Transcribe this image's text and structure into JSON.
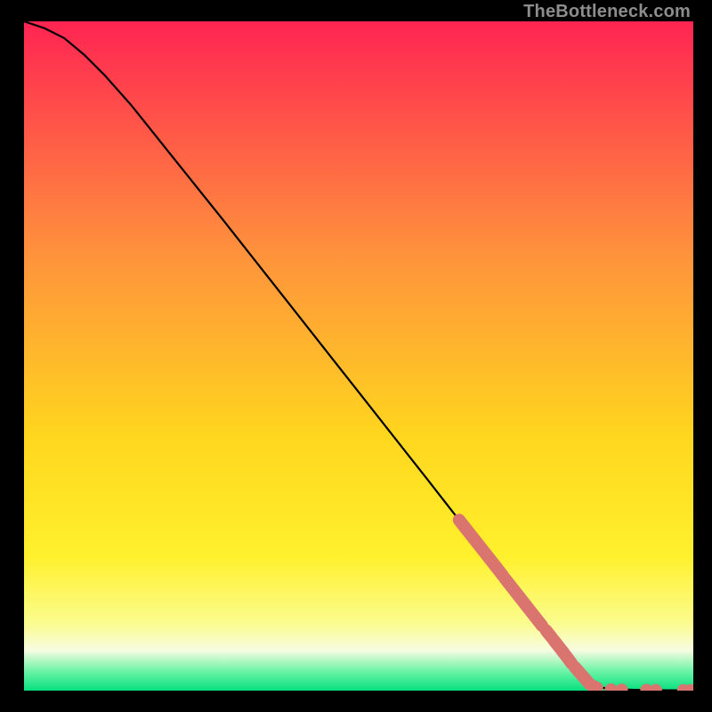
{
  "watermark": "TheBottleneck.com",
  "colors": {
    "page_bg": "#000000",
    "curve": "#000000",
    "marker_fill": "#d9746f",
    "marker_stroke": "#d9746f",
    "grad_top": "#ff2452",
    "grad_upper_mid": "#ff933c",
    "grad_mid": "#ffd61e",
    "grad_yellow2": "#fff12d",
    "grad_pale": "#fbfc8f",
    "grad_cream": "#f7fce1",
    "grad_mint": "#6ff4a8",
    "grad_bottom": "#07e07e"
  },
  "chart_data": {
    "type": "line",
    "title": "",
    "xlabel": "",
    "ylabel": "",
    "xlim": [
      0,
      100
    ],
    "ylim": [
      0,
      100
    ],
    "grid": false,
    "legend": "none",
    "curve": [
      {
        "x": 0.0,
        "y": 100.0
      },
      {
        "x": 3.0,
        "y": 99.0
      },
      {
        "x": 6.0,
        "y": 97.5
      },
      {
        "x": 9.0,
        "y": 95.0
      },
      {
        "x": 12.0,
        "y": 92.0
      },
      {
        "x": 16.0,
        "y": 87.5
      },
      {
        "x": 22.0,
        "y": 80.0
      },
      {
        "x": 30.0,
        "y": 70.0
      },
      {
        "x": 40.0,
        "y": 57.3
      },
      {
        "x": 50.0,
        "y": 44.6
      },
      {
        "x": 60.0,
        "y": 31.9
      },
      {
        "x": 65.0,
        "y": 25.5
      },
      {
        "x": 70.0,
        "y": 19.2
      },
      {
        "x": 75.0,
        "y": 12.8
      },
      {
        "x": 80.0,
        "y": 6.4
      },
      {
        "x": 84.0,
        "y": 1.5
      },
      {
        "x": 86.0,
        "y": 0.5
      },
      {
        "x": 88.0,
        "y": 0.2
      },
      {
        "x": 92.0,
        "y": 0.1
      },
      {
        "x": 96.0,
        "y": 0.05
      },
      {
        "x": 100.0,
        "y": 0.05
      }
    ],
    "marker_segments": [
      {
        "x1": 65.0,
        "y1": 25.5,
        "x2": 70.6,
        "y2": 18.4
      },
      {
        "x1": 70.6,
        "y1": 18.4,
        "x2": 71.6,
        "y2": 17.1
      },
      {
        "x1": 71.9,
        "y1": 16.7,
        "x2": 77.4,
        "y2": 9.7
      },
      {
        "x1": 78.0,
        "y1": 9.0,
        "x2": 78.8,
        "y2": 8.0
      },
      {
        "x1": 79.1,
        "y1": 7.6,
        "x2": 80.6,
        "y2": 5.7
      },
      {
        "x1": 80.6,
        "y1": 5.7,
        "x2": 81.8,
        "y2": 4.1
      },
      {
        "x1": 82.3,
        "y1": 3.5,
        "x2": 84.5,
        "y2": 1.0
      },
      {
        "x1": 84.8,
        "y1": 0.8,
        "x2": 85.6,
        "y2": 0.4
      }
    ],
    "marker_points": [
      {
        "x": 87.7,
        "y": 0.15
      },
      {
        "x": 89.3,
        "y": 0.12
      },
      {
        "x": 93.0,
        "y": 0.08
      },
      {
        "x": 94.4,
        "y": 0.06
      },
      {
        "x": 98.5,
        "y": 0.05
      },
      {
        "x": 99.6,
        "y": 0.05
      }
    ]
  }
}
